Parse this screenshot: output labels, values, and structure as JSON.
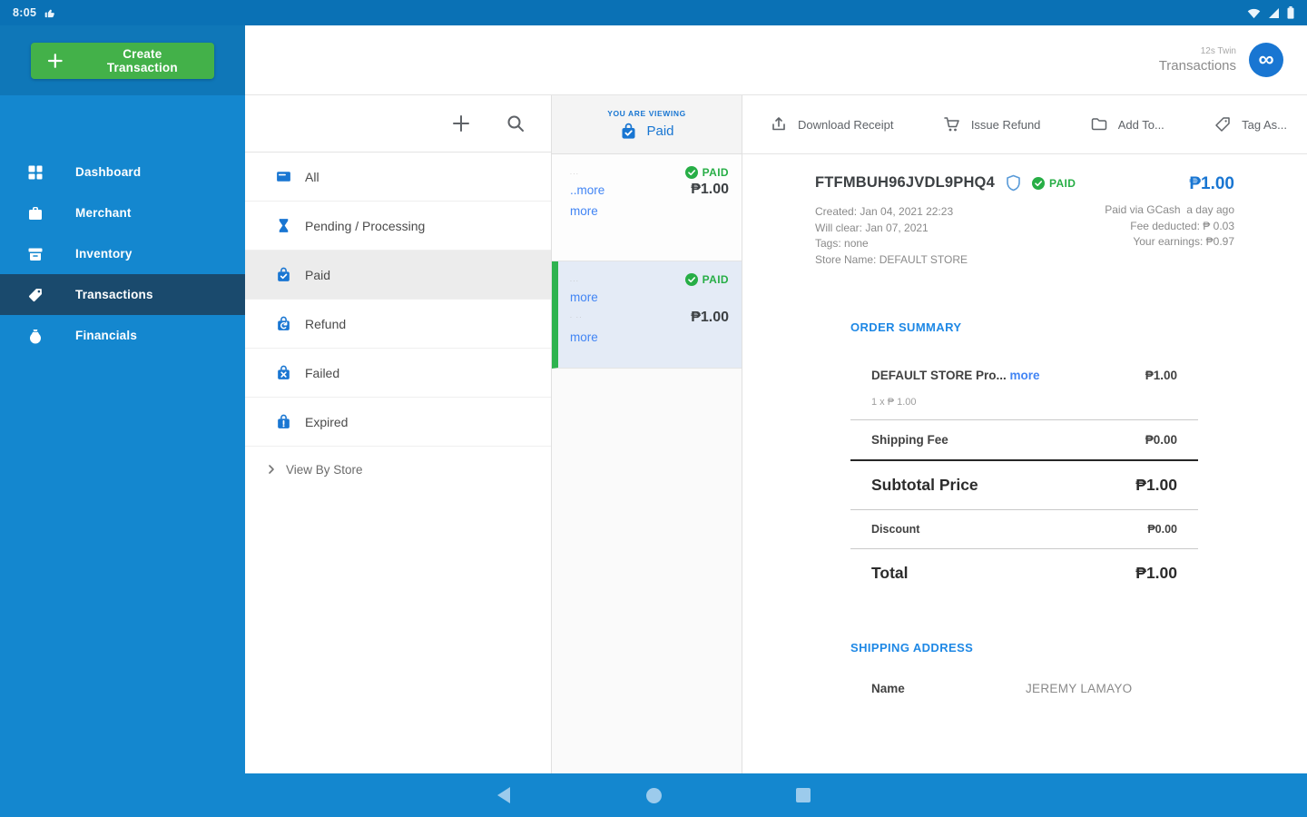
{
  "colors": {
    "sidebar_blue": "#1487cf",
    "sidebar_header_blue": "#0f77b8",
    "statusbar_blue": "#0a71b5",
    "selected_nav": "#1a4a6d",
    "accent_blue": "#1976d2",
    "link_blue": "#4285f4",
    "green_button": "#43b149",
    "paid_green": "#27ae46",
    "selected_card_bg": "#e4ebf6",
    "selected_card_bar": "#2eb34f"
  },
  "status_bar": {
    "time": "8:05"
  },
  "sidebar": {
    "create_button": "Create Transaction",
    "items": [
      {
        "label": "Dashboard"
      },
      {
        "label": "Merchant"
      },
      {
        "label": "Inventory"
      },
      {
        "label": "Transactions"
      },
      {
        "label": "Financials"
      }
    ]
  },
  "header": {
    "subtitle": "12s Twin",
    "title": "Transactions",
    "avatar_glyph": "∞"
  },
  "filters": {
    "items": [
      {
        "label": "All"
      },
      {
        "label": "Pending / Processing"
      },
      {
        "label": "Paid"
      },
      {
        "label": "Refund"
      },
      {
        "label": "Failed"
      },
      {
        "label": "Expired"
      }
    ],
    "view_by_store": "View By Store"
  },
  "viewing": {
    "caption": "YOU ARE VIEWING",
    "value": "Paid"
  },
  "transactions": [
    {
      "muted1": "...",
      "link1": "..more",
      "link2": "more",
      "status": "PAID",
      "amount": "₱1.00"
    },
    {
      "muted1": "...",
      "link1": "more",
      "muted2": ". ..",
      "link2": "more",
      "status": "PAID",
      "amount": "₱1.00"
    }
  ],
  "toolbar": {
    "download": "Download Receipt",
    "refund": "Issue Refund",
    "add_to": "Add To...",
    "tag_as": "Tag As..."
  },
  "detail": {
    "id": "FTFMBUH96JVDL9PHQ4",
    "status": "PAID",
    "amount": "₱1.00",
    "meta_left": {
      "created": "Created: Jan 04, 2021 22:23",
      "clear": "Will clear: Jan 07, 2021",
      "tags": "Tags: none",
      "store": "Store Name: DEFAULT STORE"
    },
    "meta_right": {
      "paid_via": "Paid via GCash  a day ago",
      "fee": "Fee deducted: ₱ 0.03",
      "earnings": "Your earnings: ₱0.97"
    },
    "order_summary": {
      "heading": "ORDER SUMMARY",
      "item_name": "DEFAULT STORE Pro...",
      "item_more": "more",
      "item_price": "₱1.00",
      "item_qty": "1 x ₱ 1.00",
      "shipping_label": "Shipping Fee",
      "shipping_value": "₱0.00",
      "subtotal_label": "Subtotal Price",
      "subtotal_value": "₱1.00",
      "discount_label": "Discount",
      "discount_value": "₱0.00",
      "total_label": "Total",
      "total_value": "₱1.00"
    },
    "shipping_address": {
      "heading": "SHIPPING ADDRESS",
      "name_label": "Name",
      "name_value": "JEREMY LAMAYO"
    }
  }
}
